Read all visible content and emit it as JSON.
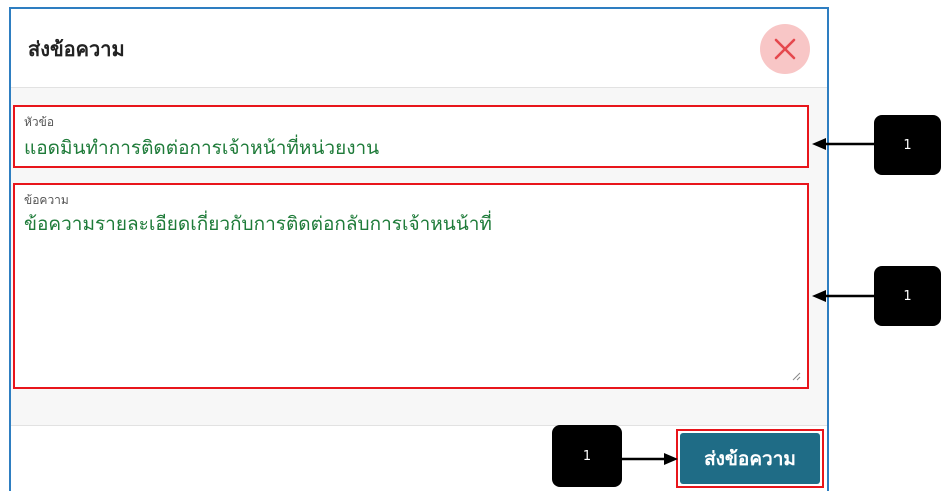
{
  "modal": {
    "title": "ส่งข้อความ",
    "close_icon": "close-x-icon"
  },
  "form": {
    "subject": {
      "label": "หัวข้อ",
      "value": "แอดมินทำการติดต่อการเจ้าหน้าที่หน่วยงาน"
    },
    "message": {
      "label": "ข้อความ",
      "value": "ข้อความรายละเอียดเกี่ยวกับการติดต่อกลับการเจ้าหนน้าที่"
    }
  },
  "footer": {
    "send_label": "ส่งข้อความ"
  },
  "annotations": {
    "callout_subject": "1",
    "callout_message": "1",
    "callout_send": "1"
  },
  "colors": {
    "accent_border": "#2e7ec1",
    "highlight": "#e8151b",
    "input_text": "#1e7b39",
    "button_bg": "#1f6c86",
    "close_bg": "#f8c6c6",
    "close_x": "#e5484d"
  }
}
